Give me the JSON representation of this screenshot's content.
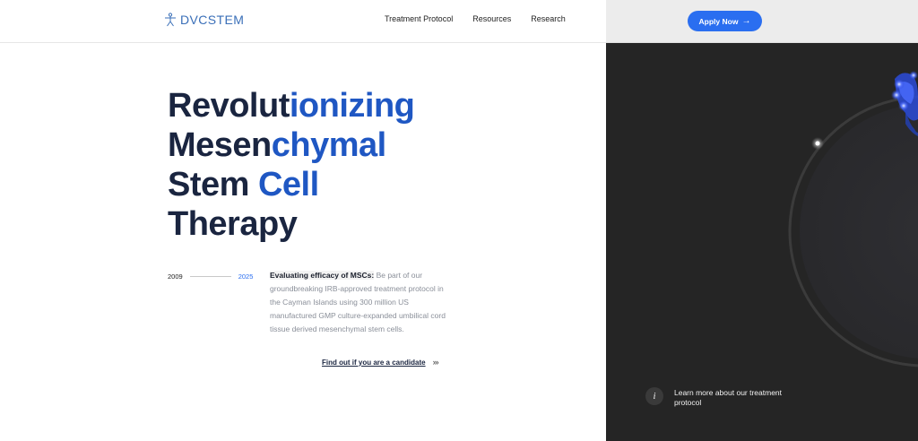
{
  "header": {
    "logo": {
      "part1": "DVC",
      "part2": "STEM",
      "icon": "vitruvian-figure-icon"
    },
    "nav": [
      {
        "label": "Treatment Protocol"
      },
      {
        "label": "Resources"
      },
      {
        "label": "Research"
      }
    ],
    "apply_button": {
      "label": "Apply Now",
      "icon": "arrow-right-icon"
    }
  },
  "hero": {
    "title_lines": [
      {
        "dark": "Revolut",
        "blue": "ionizing"
      },
      {
        "dark": "Mesen",
        "blue": "chymal"
      },
      {
        "dark": "Stem ",
        "blue": "Cell"
      },
      {
        "dark": "Therapy",
        "blue": ""
      }
    ],
    "timeline": {
      "start": "2009",
      "end": "2025"
    },
    "description": {
      "bold": "Evaluating efficacy of MSCs:",
      "text": " Be part of our groundbreaking IRB-approved treatment protocol in the Cayman Islands using 300 million US manufactured GMP culture-expanded umbilical cord tissue derived mesenchymal stem cells."
    },
    "cta": {
      "label": "Find out if you are a candidate",
      "icon": "double-chevron-right-icon"
    }
  },
  "panel": {
    "info_icon": "info-icon",
    "info_text": "Learn more about our treatment protocol"
  },
  "colors": {
    "accent_blue": "#2a6ef0",
    "title_blue": "#1f57c3",
    "title_dark": "#1a2540",
    "panel_bg": "#252525"
  }
}
